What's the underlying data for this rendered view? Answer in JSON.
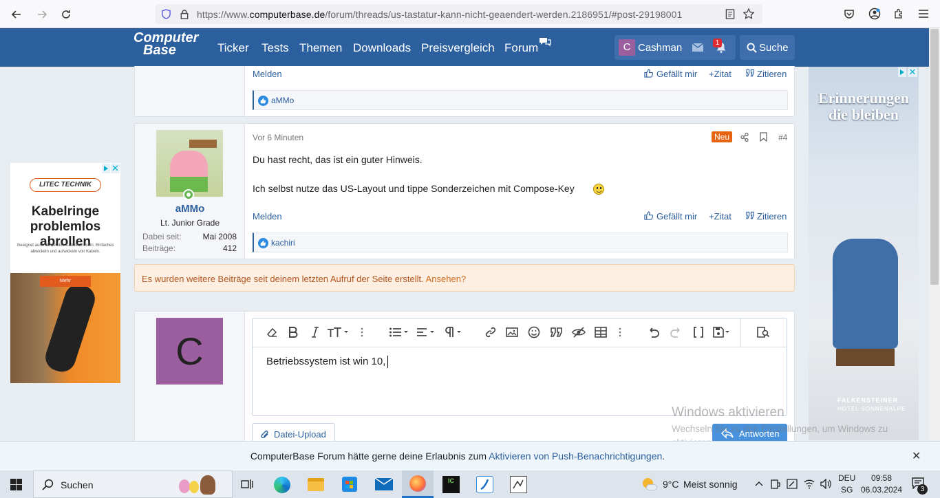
{
  "browser": {
    "url_prefix": "https://www.",
    "url_domain": "computerbase.de",
    "url_path": "/forum/threads/us-tastatur-kann-nicht-geaendert-werden.2186951/#post-29198001"
  },
  "site": {
    "logo_line1": "Computer",
    "logo_line2": "Base",
    "nav": [
      "Ticker",
      "Tests",
      "Themen",
      "Downloads",
      "Preisvergleich",
      "Forum"
    ],
    "user_initial": "C",
    "username": "Cashman",
    "alert_count": "1",
    "search_label": "Suche"
  },
  "prev_post": {
    "report": "Melden",
    "like": "Gefällt mir",
    "zitat": "Zitat",
    "zitieren": "Zitieren",
    "liked_by": "aMMo"
  },
  "post": {
    "time": "Vor 6 Minuten",
    "badge": "Neu",
    "number": "#4",
    "line1": "Du hast recht, das ist ein guter Hinweis.",
    "line2": "Ich selbst nutze das US-Layout und tippe Sonderzeichen mit Compose-Key",
    "author": "aMMo",
    "rank": "Lt. Junior Grade",
    "joined_label": "Dabei seit:",
    "joined": "Mai 2008",
    "posts_label": "Beiträge:",
    "posts": "412",
    "report": "Melden",
    "like": "Gefällt mir",
    "zitat": "Zitat",
    "zitieren": "Zitieren",
    "liked_by": "kachiri"
  },
  "notice": {
    "text": "Es wurden weitere Beiträge seit deinem letzten Aufruf der Seite erstellt.",
    "link": "Ansehen?"
  },
  "reply": {
    "user_initial": "C",
    "editor_text": "Betriebssystem ist win 10,",
    "upload_label": "Datei-Upload",
    "answer_label": "Antworten"
  },
  "ads": {
    "left_brand": "LITEC TECHNIK",
    "left_headline": "Kabelringe problemlos abrollen",
    "left_sub": "Geeignet auch für defekte Kabeltrommeln. Einfaches abwickeln und aufwickeln von Kabeln.",
    "left_button": "Mehr",
    "right_headline": "Erinnerungen die bleiben",
    "right_brand": "FALKENSTEINER",
    "right_sub": "HOTEL SONNENALPE"
  },
  "watermark": {
    "title": "Windows aktivieren",
    "text": "Wechseln Sie zu den Einstellungen, um Windows zu aktivieren."
  },
  "push": {
    "text": "ComputerBase Forum hätte gerne deine Erlaubnis zum",
    "link": "Aktivieren von Push-Benachrichtigungen",
    "end": "."
  },
  "taskbar": {
    "search": "Suchen",
    "weather_temp": "9°C",
    "weather_text": "Meist sonnig",
    "lang": "DEU",
    "lang2": "SG",
    "time": "09:58",
    "date": "06.03.2024",
    "notif_count": "3"
  }
}
